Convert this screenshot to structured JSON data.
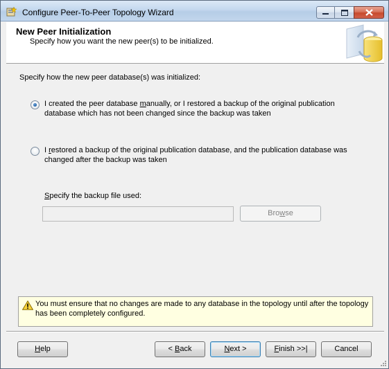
{
  "window": {
    "title": "Configure Peer-To-Peer Topology Wizard",
    "controls": [
      "minimize",
      "maximize",
      "close"
    ]
  },
  "header": {
    "title": "New Peer Initialization",
    "subtitle": "Specify how you want the new peer(s) to be initialized."
  },
  "main": {
    "prompt": "Specify how the new peer database(s) was initialized:",
    "options": [
      {
        "label_pre": "I created the peer database ",
        "label_key": "m",
        "label_post": "anually, or I restored a backup of the original publication database which has not been changed since the backup was taken",
        "selected": true
      },
      {
        "label_pre": "I ",
        "label_key": "r",
        "label_post": "estored a backup of the original publication database, and the publication database was changed after the backup was taken",
        "selected": false
      }
    ],
    "backup_label_key": "S",
    "backup_label_rest": "pecify the backup file used:",
    "backup_value": "",
    "browse": {
      "pre": "Bro",
      "key": "w",
      "post": "se"
    }
  },
  "warning": {
    "icon": "warning-triangle-icon",
    "text": "You must ensure that no changes are made to any database in the topology until after the topology has been completely configured."
  },
  "footer": {
    "help": {
      "pre": "",
      "key": "H",
      "post": "elp"
    },
    "back": {
      "pre": "< ",
      "key": "B",
      "post": "ack"
    },
    "next": {
      "pre": "",
      "key": "N",
      "post": "ext >"
    },
    "finish": {
      "pre": "",
      "key": "F",
      "post": "inish >>|"
    },
    "cancel": "Cancel"
  }
}
